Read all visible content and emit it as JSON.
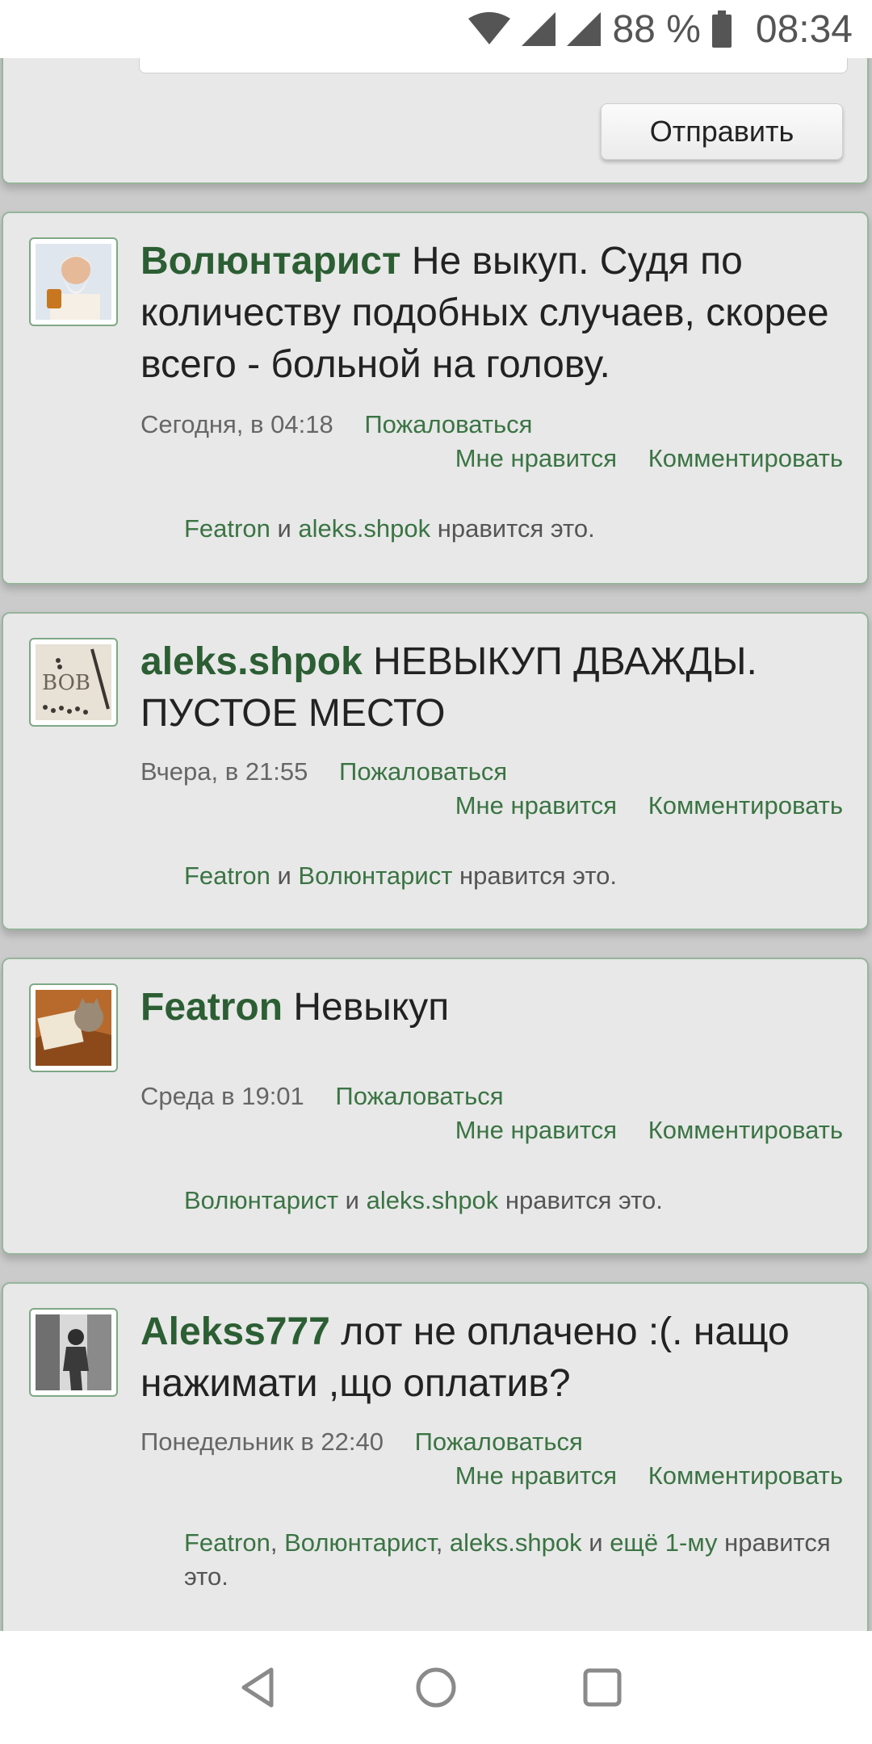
{
  "status_bar": {
    "battery": "88 %",
    "time": "08:34",
    "icons": [
      "wifi-icon",
      "signal-icon",
      "signal-icon",
      "battery-icon"
    ]
  },
  "reply": {
    "send_label": "Отправить"
  },
  "comments": [
    {
      "author": "Волюнтарист",
      "text": "Не выкуп. Судя по количеству подобных случаев, скорее всего - больной на голову.",
      "time": "Сегодня, в 04:18",
      "complain": "Пожаловаться",
      "like": "Мне нравится",
      "reply": "Комментировать",
      "likers": [
        "Featron",
        "aleks.shpok"
      ],
      "likers_sep": [
        " и "
      ],
      "likes_suffix": " нравится это."
    },
    {
      "author": "aleks.shpok",
      "text": "НЕВЫКУП ДВАЖДЫ. ПУСТОЕ МЕСТО",
      "time": "Вчера, в 21:55",
      "complain": "Пожаловаться",
      "like": "Мне нравится",
      "reply": "Комментировать",
      "likers": [
        "Featron",
        "Волюнтарист"
      ],
      "likers_sep": [
        " и "
      ],
      "likes_suffix": " нравится это."
    },
    {
      "author": "Featron",
      "text": "Невыкуп",
      "time": "Среда в 19:01",
      "complain": "Пожаловаться",
      "like": "Мне нравится",
      "reply": "Комментировать",
      "likers": [
        "Волюнтарист",
        "aleks.shpok"
      ],
      "likers_sep": [
        " и "
      ],
      "likes_suffix": " нравится это."
    },
    {
      "author": "Alekss777",
      "text": "лот не оплачено :(. нащо нажимати ,що оплатив?",
      "time": "Понедельник в 22:40",
      "complain": "Пожаловаться",
      "like": "Мне нравится",
      "reply": "Комментировать",
      "likers": [
        "Featron",
        "Волюнтарист",
        "aleks.shpok",
        "ещё 1-му"
      ],
      "likers_sep": [
        ", ",
        ", ",
        " и "
      ],
      "likes_suffix": " нравится это."
    }
  ],
  "nav": {
    "buttons": [
      "back-icon",
      "home-icon",
      "recents-icon"
    ]
  },
  "colors": {
    "accent": "#2c5e33",
    "link": "#3a7443",
    "card_bg": "#e8e8e8",
    "card_border": "#97b59c"
  }
}
